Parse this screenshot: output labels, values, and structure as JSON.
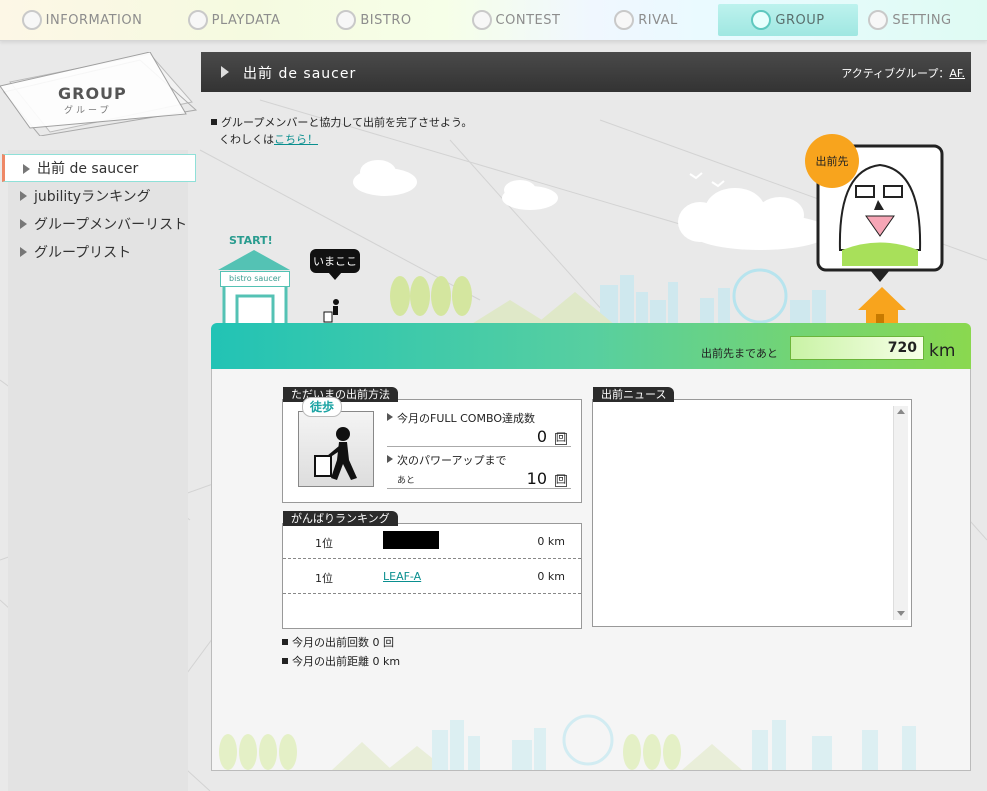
{
  "nav": [
    {
      "label": "INFORMATION",
      "icon": "info-icon"
    },
    {
      "label": "PLAYDATA",
      "icon": "playdata-icon"
    },
    {
      "label": "BISTRO",
      "icon": "bistro-icon"
    },
    {
      "label": "CONTEST",
      "icon": "contest-icon"
    },
    {
      "label": "RIVAL",
      "icon": "rival-icon"
    },
    {
      "label": "GROUP",
      "icon": "group-icon",
      "active": true
    },
    {
      "label": "SETTING",
      "icon": "setting-icon"
    }
  ],
  "sidebar": {
    "title": "GROUP",
    "subtitle": "グループ",
    "items": [
      {
        "label": "出前 de saucer",
        "active": true
      },
      {
        "label": "jubilityランキング"
      },
      {
        "label": "グループメンバーリスト"
      },
      {
        "label": "グループリスト"
      }
    ]
  },
  "header": {
    "title": "出前 de saucer",
    "active_group_label": "アクティブグループ：",
    "active_group_value": "AF."
  },
  "intro": {
    "line1": "グループメンバーと協力して出前を完了させよう。",
    "line2_prefix": "くわしくは",
    "line2_link": "こちら！"
  },
  "scene": {
    "start_label": "START!",
    "shop_label": "bistro saucer",
    "bubble": "いまここ",
    "destination_badge": "出前先"
  },
  "progress": {
    "label": "出前先まであと",
    "value": "720",
    "unit": "km"
  },
  "method": {
    "tab": "ただいまの出前方法",
    "mode": "徒歩",
    "fullcombo_label": "今月のFULL COMBO達成数",
    "fullcombo_value": "0",
    "fullcombo_unit": "回",
    "powerup_label": "次のパワーアップまで",
    "powerup_prefix": "あと",
    "powerup_value": "10",
    "powerup_unit": "回"
  },
  "ranking": {
    "tab": "がんばりランキング",
    "rows": [
      {
        "rank": "1位",
        "name": "",
        "km": "0 km",
        "redacted": true
      },
      {
        "rank": "1位",
        "name": "LEAF-A",
        "km": "0 km"
      }
    ]
  },
  "totals": {
    "count": "今月の出前回数 0 回",
    "distance": "今月の出前距離 0 km"
  },
  "news": {
    "tab": "出前ニュース"
  },
  "colors": {
    "accent_teal": "#22c3b5",
    "accent_green": "#8ad84f",
    "destination_orange": "#f8a41d",
    "link": "#0a8f8f"
  }
}
